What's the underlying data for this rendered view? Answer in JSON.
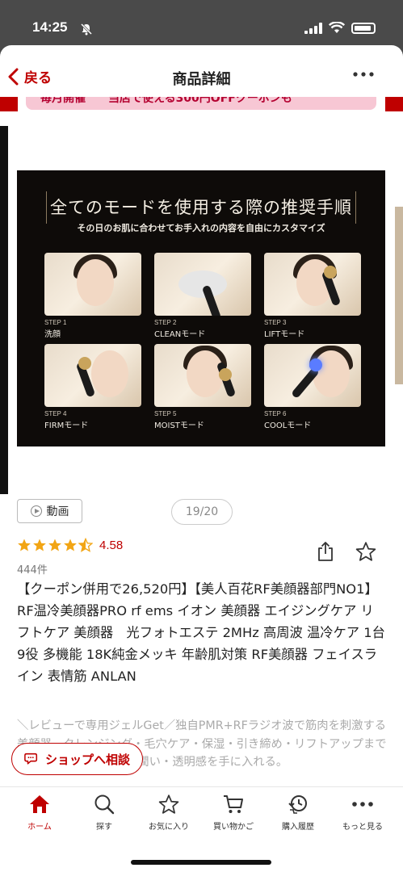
{
  "status": {
    "time": "14:25"
  },
  "nav": {
    "back_label": "戻る",
    "title": "商品詳細"
  },
  "promo": {
    "text": "毎月開催　　当店で使える300円OFFクーポンも"
  },
  "product_image": {
    "title": "全てのモードを使用する際の推奨手順",
    "subtitle": "その日のお肌に合わせてお手入れの内容を自由にカスタマイズ",
    "steps": [
      {
        "step": "STEP 1",
        "name": "洗顔"
      },
      {
        "step": "STEP 2",
        "name": "CLEANモード"
      },
      {
        "step": "STEP 3",
        "name": "LIFTモード"
      },
      {
        "step": "STEP 4",
        "name": "FIRMモード"
      },
      {
        "step": "STEP 5",
        "name": "MOISTモード"
      },
      {
        "step": "STEP 6",
        "name": "COOLモード"
      }
    ]
  },
  "gallery": {
    "video_label": "動画",
    "counter": "19/20"
  },
  "rating": {
    "value": "4.58",
    "stars": 4.5,
    "review_count": "444件"
  },
  "product": {
    "title": "【クーポン併用で26,520円】【美人百花RF美顔器部門NO1】RF温冷美顔器PRO rf ems イオン 美顔器 エイジングケア リフトケア 美顔器　光フォトエステ 2MHz 高周波 温冷ケア 1台9役 多機能 18K純金メッキ 年齢肌対策 RF美顔器 フェイスライン 表情筋 ANLAN",
    "description": "＼レビューで専用ジェルGet／独自PMR+RFラジオ波で筋肉を刺激する美顔器、クレンジング・毛穴ケア・保湿・引き締め・リフトアップまでこれ一台でOK、ハリ・潤い・透明感を手に入れる。"
  },
  "shop_consult": {
    "label": "ショップへ相談"
  },
  "tabbar": {
    "items": [
      {
        "label": "ホーム",
        "icon": "home-icon"
      },
      {
        "label": "探す",
        "icon": "search-icon"
      },
      {
        "label": "お気に入り",
        "icon": "star-icon"
      },
      {
        "label": "買い物かご",
        "icon": "cart-icon"
      },
      {
        "label": "購入履歴",
        "icon": "history-icon"
      },
      {
        "label": "もっと見る",
        "icon": "more-icon"
      }
    ]
  },
  "colors": {
    "accent": "#bf0000",
    "star": "#f2a514"
  }
}
